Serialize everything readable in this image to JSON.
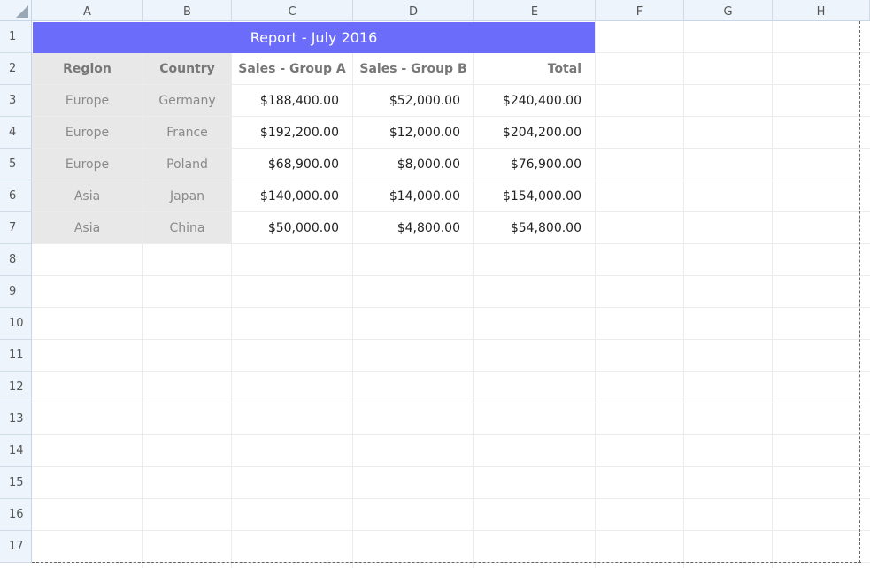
{
  "columns": [
    "A",
    "B",
    "C",
    "D",
    "E",
    "F",
    "G",
    "H"
  ],
  "rows": [
    "1",
    "2",
    "3",
    "4",
    "5",
    "6",
    "7",
    "8",
    "9",
    "10",
    "11",
    "12",
    "13",
    "14",
    "15",
    "16",
    "17"
  ],
  "title": "Report - July 2016",
  "headers": {
    "region": "Region",
    "country": "Country",
    "sales_a": "Sales - Group A",
    "sales_b": "Sales - Group B",
    "total": "Total"
  },
  "data": [
    {
      "region": "Europe",
      "country": "Germany",
      "sales_a": "$188,400.00",
      "sales_b": "$52,000.00",
      "total": "$240,400.00"
    },
    {
      "region": "Europe",
      "country": "France",
      "sales_a": "$192,200.00",
      "sales_b": "$12,000.00",
      "total": "$204,200.00"
    },
    {
      "region": "Europe",
      "country": "Poland",
      "sales_a": "$68,900.00",
      "sales_b": "$8,000.00",
      "total": "$76,900.00"
    },
    {
      "region": "Asia",
      "country": "Japan",
      "sales_a": "$140,000.00",
      "sales_b": "$14,000.00",
      "total": "$154,000.00"
    },
    {
      "region": "Asia",
      "country": "China",
      "sales_a": "$50,000.00",
      "sales_b": "$4,800.00",
      "total": "$54,800.00"
    }
  ],
  "colors": {
    "title_bg": "#6c6cfa",
    "header_bg": "#eef4fb",
    "label_bg": "#e8e8e8"
  }
}
